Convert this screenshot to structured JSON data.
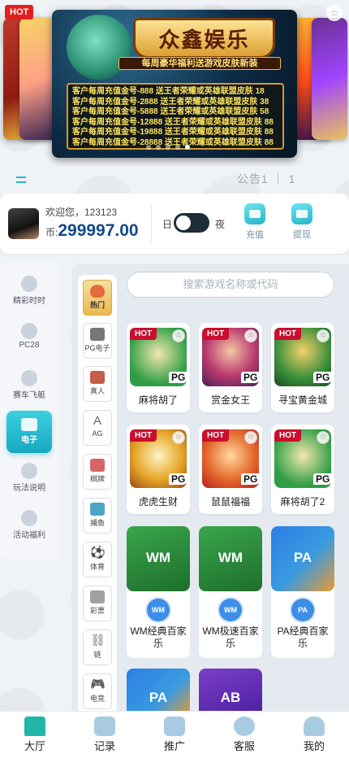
{
  "banner": {
    "hot_label": "HOT",
    "brand": "众鑫娱乐",
    "tagline": "每周豪华福利送游戏皮肤新装",
    "promo_lines": [
      "客户每周充值金号-888     送王者荣耀或英雄联盟皮肤 18",
      "客户每周充值金号-2888   送王者荣耀或英雄联盟皮肤 38",
      "客户每周充值金号-5888   送王者荣耀或英雄联盟皮肤 58",
      "客户每周充值金号-12888 送王者荣耀或英雄联盟皮肤 88",
      "客户每周充值金号-19888 送王者荣耀或英雄联盟皮肤 88",
      "客户每周充值金号-28888 送王者荣耀或英雄联盟皮肤 88"
    ],
    "star": "☆"
  },
  "notice": {
    "text": "公告1 ｜ 1"
  },
  "user": {
    "welcome": "欢迎您，123123",
    "currency": "币:",
    "balance": "299997.00",
    "day_label": "日",
    "night_label": "夜",
    "recharge_label": "充值",
    "withdraw_label": "提现"
  },
  "left_nav": [
    {
      "label": "精彩时时",
      "icon": "lottery-ball-icon"
    },
    {
      "label": "PC28",
      "icon": "pc28-icon"
    },
    {
      "label": "赛车飞艇",
      "icon": "racecar-icon"
    },
    {
      "label": "电子",
      "icon": "cards-icon",
      "active": true
    },
    {
      "label": "玩法说明",
      "icon": "rules-icon"
    },
    {
      "label": "活动福利",
      "icon": "gift-icon"
    }
  ],
  "sub_nav": [
    {
      "label": "热门",
      "icon": "flame-icon",
      "active": true
    },
    {
      "label": "PG电子",
      "icon": "slot-machine-icon"
    },
    {
      "label": "真人",
      "icon": "dealer-icon"
    },
    {
      "label": "AG",
      "icon": "ag-icon",
      "glyph": "A"
    },
    {
      "label": "棋牌",
      "icon": "poker-card-icon"
    },
    {
      "label": "捕鱼",
      "icon": "fish-icon"
    },
    {
      "label": "体育",
      "icon": "soccer-ball-icon",
      "glyph": "⚽"
    },
    {
      "label": "彩票",
      "icon": "lottery-ticket-icon"
    },
    {
      "label": "链",
      "icon": "chain-icon",
      "glyph": "⛓"
    },
    {
      "label": "电竞",
      "icon": "gamepad-icon",
      "glyph": "🎮"
    }
  ],
  "search": {
    "placeholder": "搜索游戏名称或代码"
  },
  "games_pg": [
    {
      "name": "麻将胡了",
      "hot": "HOT",
      "brand": "PG",
      "thumb_color": "#2f9e44"
    },
    {
      "name": "赏金女王",
      "hot": "HOT",
      "brand": "PG",
      "thumb_color": "#b83a6e"
    },
    {
      "name": "寻宝黄金城",
      "hot": "HOT",
      "brand": "PG",
      "thumb_color": "#3a8f3a"
    },
    {
      "name": "虎虎生财",
      "hot": "HOT",
      "brand": "PG",
      "thumb_color": "#c98a1a"
    },
    {
      "name": "鼠鼠福福",
      "hot": "HOT",
      "brand": "PG",
      "thumb_color": "#d9532b"
    },
    {
      "name": "麻将胡了2",
      "hot": "HOT",
      "brand": "PG",
      "thumb_color": "#2f9e44"
    }
  ],
  "games_table": [
    {
      "tile": "WM",
      "badge": "WM",
      "name": "WM经典百家乐",
      "color": "#2e8b3e"
    },
    {
      "tile": "WM",
      "badge": "WM",
      "name": "WM极速百家乐",
      "color": "#2e8b3e"
    },
    {
      "tile": "PA",
      "badge": "PA",
      "name": "PA经典百家乐",
      "color": "#2a7fe0"
    }
  ],
  "games_more": [
    {
      "tile": "PA",
      "color": "#2a7fe0"
    },
    {
      "tile": "AB",
      "color": "#6a2bb3"
    }
  ],
  "bottom_nav": [
    {
      "label": "大厅",
      "icon": "home-icon",
      "active": true
    },
    {
      "label": "记录",
      "icon": "footprint-icon"
    },
    {
      "label": "推广",
      "icon": "paper-plane-icon"
    },
    {
      "label": "客服",
      "icon": "headset-icon"
    },
    {
      "label": "我的",
      "icon": "user-icon"
    }
  ]
}
